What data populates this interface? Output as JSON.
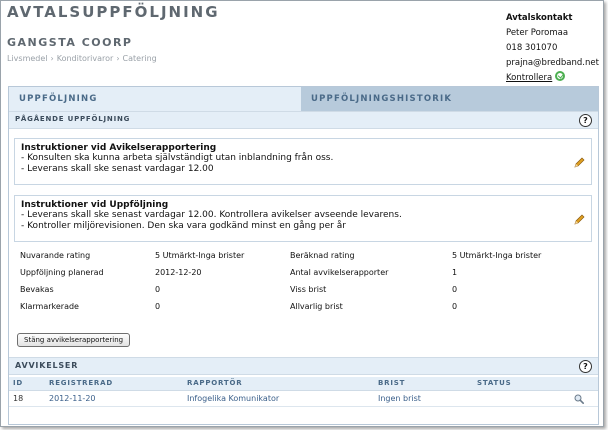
{
  "header": {
    "title": "AVTALSUPPFÖLJNING",
    "company": "GANGSTA COORP",
    "breadcrumb": [
      "Livsmedel",
      "Konditorivaror",
      "Catering"
    ],
    "breadcrumb_separator": "›"
  },
  "contact": {
    "heading": "Avtalskontakt",
    "name": "Peter Poromaa",
    "phone": "018 301070",
    "email": "prajna@bredband.net",
    "check_label": "Kontrollera",
    "check_icon": "ok-circle-icon",
    "check_icon_color": "#4caf50"
  },
  "tabs": [
    {
      "label": "UPPFÖLJNING",
      "active": true
    },
    {
      "label": "UPPFÖLJNINGSHISTORIK",
      "active": false
    }
  ],
  "ongoing": {
    "section_label": "PÅGÅENDE UPPFÖLJNING",
    "help_label": "?",
    "notes": [
      {
        "title": "Instruktioner vid Avikelserapportering",
        "lines": [
          "- Konsulten ska kunna arbeta självständigt utan inblandning från oss.",
          "- Leverans skall ske senast vardagar 12.00"
        ]
      },
      {
        "title": "Instruktioner vid Uppföljning",
        "lines": [
          "- Leverans skall ske senast vardagar 12.00. Kontrollera avikelser avseende levarens.",
          "- Kontroller miljörevisionen. Den ska vara godkänd minst en gång per år"
        ]
      }
    ],
    "stats": [
      {
        "label": "Nuvarande rating",
        "value": "5 Utmärkt-Inga brister",
        "label2": "Beräknad rating",
        "value2": "5 Utmärkt-Inga brister"
      },
      {
        "label": "Uppföljning planerad",
        "value": "2012-12-20",
        "label2": "Antal avvikelserapporter",
        "value2": "1"
      },
      {
        "label": "Bevakas",
        "value": "0",
        "label2": "Viss brist",
        "value2": "0"
      },
      {
        "label": "Klarmarkerade",
        "value": "0",
        "label2": "Allvarlig brist",
        "value2": "0"
      }
    ],
    "close_button": "Stäng avvikelserapportering"
  },
  "deviations": {
    "section_label": "AVVIKELSER",
    "help_label": "?",
    "columns": [
      "ID",
      "REGISTRERAD",
      "RAPPORTÖR",
      "BRIST",
      "STATUS"
    ],
    "rows": [
      {
        "id": "18",
        "registered": "2012-11-20",
        "reporter": "Infogelika Komunikator",
        "defect": "Ingen brist",
        "status": ""
      }
    ]
  },
  "colors": {
    "accent": "#4a6a88",
    "tab_bar": "#c9d9e8",
    "section_bg": "#e4eef7",
    "pencil": "#e0a020"
  }
}
